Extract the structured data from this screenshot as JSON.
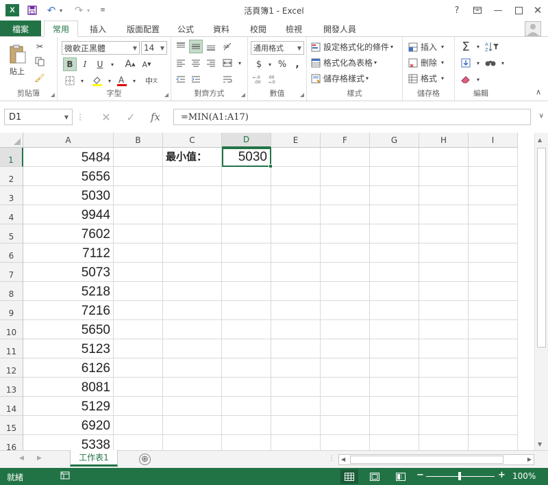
{
  "window": {
    "title": "活頁簿1 - Excel",
    "help": "?",
    "app_icon": "excel-logo-icon"
  },
  "ribbon_tabs": [
    "檔案",
    "常用",
    "插入",
    "版面配置",
    "公式",
    "資料",
    "校閱",
    "檢視",
    "開發人員"
  ],
  "active_tab": "常用",
  "clipboard": {
    "paste_label": "貼上",
    "group_label": "剪貼簿"
  },
  "font": {
    "font_name": "微軟正黑體",
    "font_size": "14",
    "bold": "B",
    "italic": "I",
    "underline": "U",
    "group_label": "字型",
    "grow": "A",
    "shrink": "A",
    "phonetic": "中"
  },
  "alignment": {
    "group_label": "對齊方式"
  },
  "number": {
    "format": "通用格式",
    "currency": "$",
    "percent": "%",
    "comma": ",",
    "group_label": "數值"
  },
  "styles": {
    "conditional": "設定格式化的條件",
    "as_table": "格式化為表格",
    "cell_styles": "儲存格樣式",
    "group_label": "樣式"
  },
  "cells_group": {
    "insert": "插入",
    "delete": "刪除",
    "format": "格式",
    "group_label": "儲存格"
  },
  "editing": {
    "group_label": "編輯"
  },
  "formula_bar": {
    "name_box": "D1",
    "formula": "=MIN(A1:A17)",
    "fx": "fx"
  },
  "columns": [
    "A",
    "B",
    "C",
    "D",
    "E",
    "F",
    "G",
    "H",
    "I"
  ],
  "selected_column": "D",
  "rows": [
    "1",
    "2",
    "3",
    "4",
    "5",
    "6",
    "7",
    "8",
    "9",
    "10",
    "11",
    "12",
    "13",
    "14",
    "15",
    "16"
  ],
  "selected_row": "1",
  "column_a_values": [
    "5484",
    "5656",
    "5030",
    "9944",
    "7602",
    "7112",
    "5073",
    "5218",
    "7216",
    "5650",
    "5123",
    "6126",
    "8081",
    "5129",
    "6920",
    "5338"
  ],
  "c1_label": "最小值：",
  "d1_value": "5030",
  "sheet": {
    "tab_name": "工作表1",
    "add_sheet": "⊕"
  },
  "status": {
    "ready": "就緒",
    "zoom": "100%"
  },
  "colors": {
    "excel_green": "#217346",
    "selected_header_bg": "#e1e1e1"
  }
}
